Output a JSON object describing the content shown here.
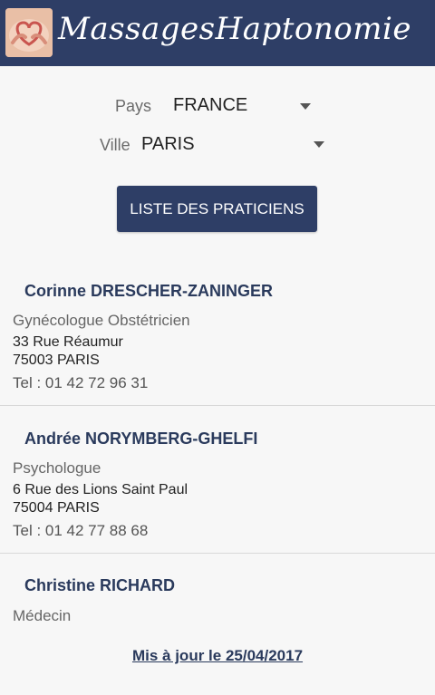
{
  "app": {
    "title": "MassagesHaptonomie",
    "header_color": "#2e3e66"
  },
  "filters": {
    "country_label": "Pays",
    "country_value": "FRANCE",
    "city_label": "Ville",
    "city_value": "PARIS"
  },
  "button": {
    "label": "LISTE DES PRATICIENS"
  },
  "practitioners": [
    {
      "name": "Corinne DRESCHER-ZANINGER",
      "specialty": "Gynécologue Obstétricien",
      "address1": "33 Rue Réaumur",
      "address2": "75003 PARIS",
      "phone": "Tel : 01 42 72 96 31"
    },
    {
      "name": "Andrée NORYMBERG-GHELFI",
      "specialty": "Psychologue",
      "address1": "6 Rue des Lions Saint Paul",
      "address2": "75004 PARIS",
      "phone": "Tel : 01 42 77 88 68"
    },
    {
      "name": "Christine RICHARD",
      "specialty": "Médecin"
    }
  ],
  "footer": {
    "updated": "Mis à jour le 25/04/2017"
  }
}
